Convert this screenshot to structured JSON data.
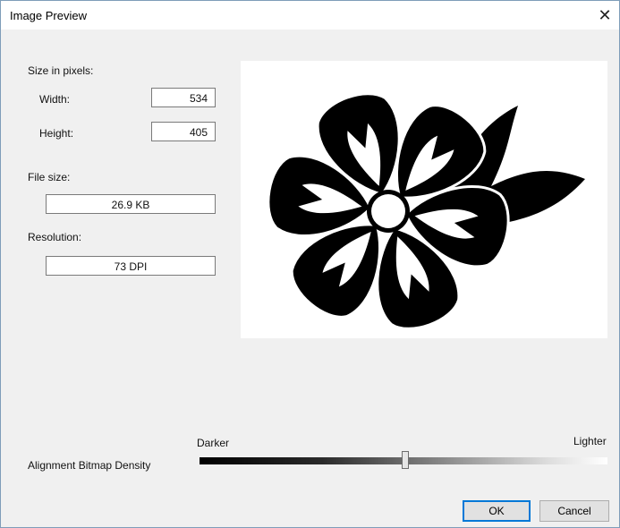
{
  "window": {
    "title": "Image Preview"
  },
  "size": {
    "heading": "Size in pixels:",
    "width_label": "Width:",
    "width_value": "534",
    "height_label": "Height:",
    "height_value": "405"
  },
  "file": {
    "label": "File size:",
    "value": "26.9 KB"
  },
  "resolution": {
    "label": "Resolution:",
    "value": "73 DPI"
  },
  "density": {
    "label": "Alignment Bitmap Density",
    "left_label": "Darker",
    "right_label": "Lighter",
    "level_percent": 51
  },
  "buttons": {
    "ok": "OK",
    "cancel": "Cancel"
  },
  "icons": {
    "close": "close-icon"
  },
  "colors": {
    "accent": "#0078d7"
  }
}
